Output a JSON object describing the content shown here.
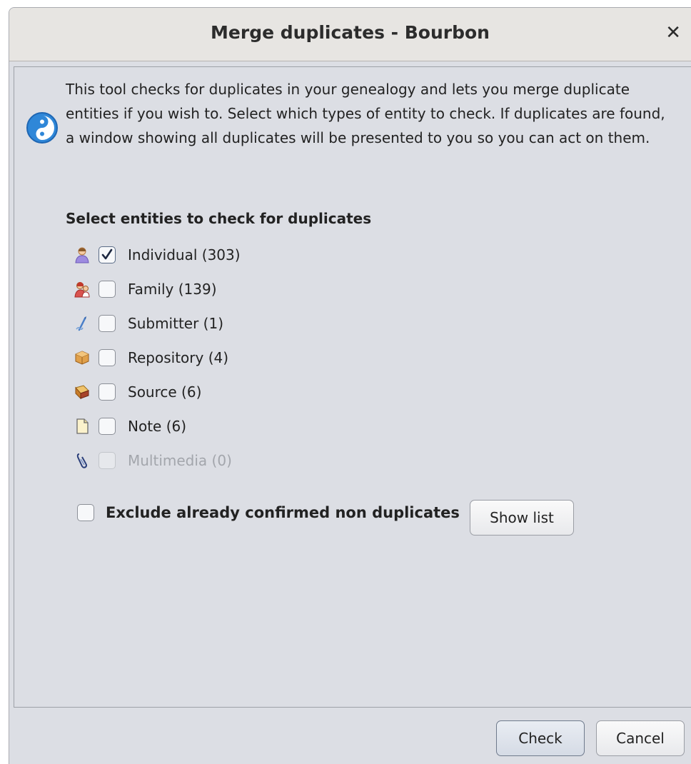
{
  "window": {
    "title": "Merge duplicates - Bourbon",
    "close_symbol": "✕"
  },
  "description": "This tool checks for duplicates in your genealogy and lets you merge duplicate entities if you wish to. Select which types of entity to check. If duplicates are found, a window showing all duplicates will be presented to you so you can act on them.",
  "section_title": "Select entities to check for duplicates",
  "entities": [
    {
      "label": "Individual (303)",
      "checked": true,
      "enabled": true,
      "icon": "individual-icon"
    },
    {
      "label": "Family (139)",
      "checked": false,
      "enabled": true,
      "icon": "family-icon"
    },
    {
      "label": "Submitter (1)",
      "checked": false,
      "enabled": true,
      "icon": "submitter-icon"
    },
    {
      "label": "Repository (4)",
      "checked": false,
      "enabled": true,
      "icon": "repository-icon"
    },
    {
      "label": "Source (6)",
      "checked": false,
      "enabled": true,
      "icon": "source-icon"
    },
    {
      "label": "Note (6)",
      "checked": false,
      "enabled": true,
      "icon": "note-icon"
    },
    {
      "label": "Multimedia (0)",
      "checked": false,
      "enabled": false,
      "icon": "multimedia-icon"
    }
  ],
  "exclude": {
    "label": "Exclude already confirmed non duplicates",
    "checked": false,
    "show_list_label": "Show list"
  },
  "buttons": {
    "check": "Check",
    "cancel": "Cancel"
  }
}
